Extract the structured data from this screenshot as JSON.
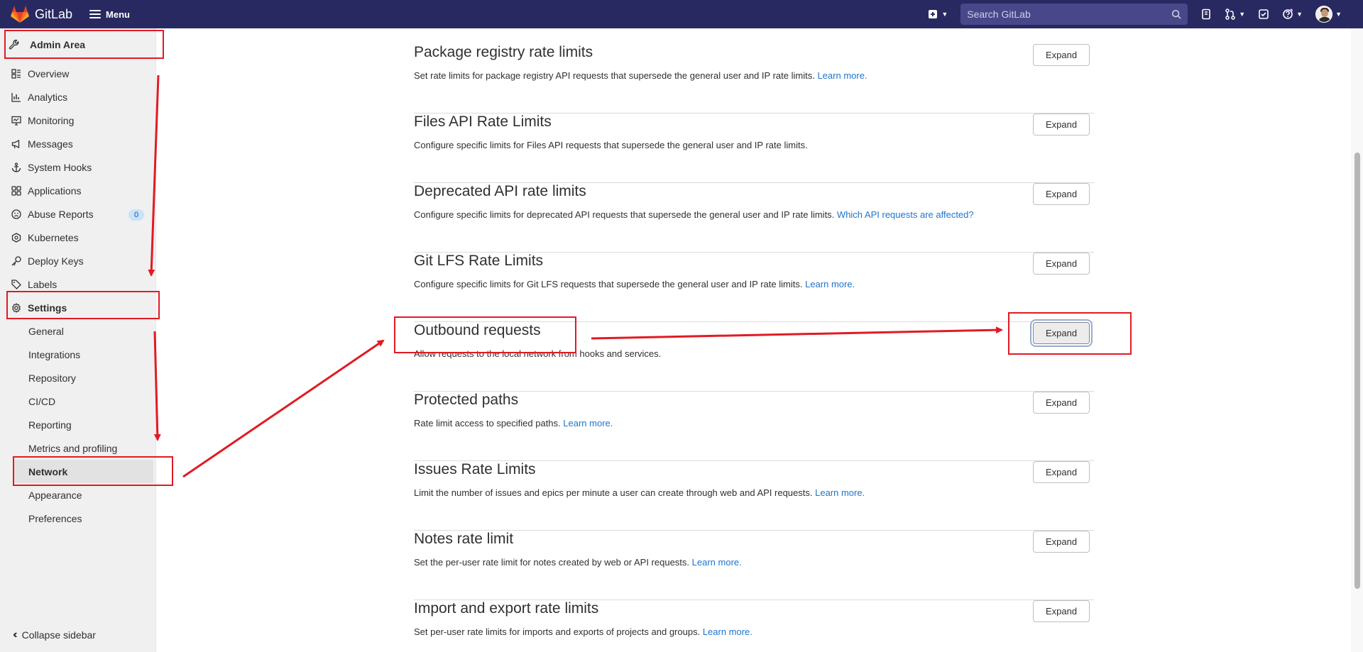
{
  "app": {
    "name": "GitLab",
    "menu_label": "Menu",
    "search_placeholder": "Search GitLab"
  },
  "sidebar": {
    "header": "Admin Area",
    "items": [
      {
        "label": "Overview",
        "icon": "overview-icon"
      },
      {
        "label": "Analytics",
        "icon": "analytics-icon"
      },
      {
        "label": "Monitoring",
        "icon": "monitoring-icon"
      },
      {
        "label": "Messages",
        "icon": "messages-icon"
      },
      {
        "label": "System Hooks",
        "icon": "system-hooks-icon"
      },
      {
        "label": "Applications",
        "icon": "applications-icon"
      },
      {
        "label": "Abuse Reports",
        "icon": "abuse-reports-icon",
        "badge": "0"
      },
      {
        "label": "Kubernetes",
        "icon": "kubernetes-icon"
      },
      {
        "label": "Deploy Keys",
        "icon": "deploy-keys-icon"
      },
      {
        "label": "Labels",
        "icon": "labels-icon"
      },
      {
        "label": "Settings",
        "icon": "settings-icon"
      }
    ],
    "settings_subitems": [
      "General",
      "Integrations",
      "Repository",
      "CI/CD",
      "Reporting",
      "Metrics and profiling",
      "Network",
      "Appearance",
      "Preferences"
    ],
    "active_subitem": "Network",
    "collapse_label": "Collapse sidebar"
  },
  "sections": [
    {
      "title": "Package registry rate limits",
      "desc": "Set rate limits for package registry API requests that supersede the general user and IP rate limits.",
      "link": "Learn more.",
      "button": "Expand"
    },
    {
      "title": "Files API Rate Limits",
      "desc": "Configure specific limits for Files API requests that supersede the general user and IP rate limits.",
      "link": "",
      "button": "Expand"
    },
    {
      "title": "Deprecated API rate limits",
      "desc": "Configure specific limits for deprecated API requests that supersede the general user and IP rate limits.",
      "link": "Which API requests are affected?",
      "button": "Expand"
    },
    {
      "title": "Git LFS Rate Limits",
      "desc": "Configure specific limits for Git LFS requests that supersede the general user and IP rate limits.",
      "link": "Learn more.",
      "button": "Expand"
    },
    {
      "title": "Outbound requests",
      "desc": "Allow requests to the local network from hooks and services.",
      "link": "",
      "button": "Expand"
    },
    {
      "title": "Protected paths",
      "desc": "Rate limit access to specified paths.",
      "link": "Learn more.",
      "button": "Expand"
    },
    {
      "title": "Issues Rate Limits",
      "desc": "Limit the number of issues and epics per minute a user can create through web and API requests.",
      "link": "Learn more.",
      "button": "Expand"
    },
    {
      "title": "Notes rate limit",
      "desc": "Set the per-user rate limit for notes created by web or API requests.",
      "link": "Learn more.",
      "button": "Expand"
    },
    {
      "title": "Import and export rate limits",
      "desc": "Set per-user rate limits for imports and exports of projects and groups.",
      "link": "Learn more.",
      "button": "Expand"
    }
  ],
  "colors": {
    "topbar": "#292961",
    "annotation": "#e01b24",
    "link": "#1f75cb"
  }
}
